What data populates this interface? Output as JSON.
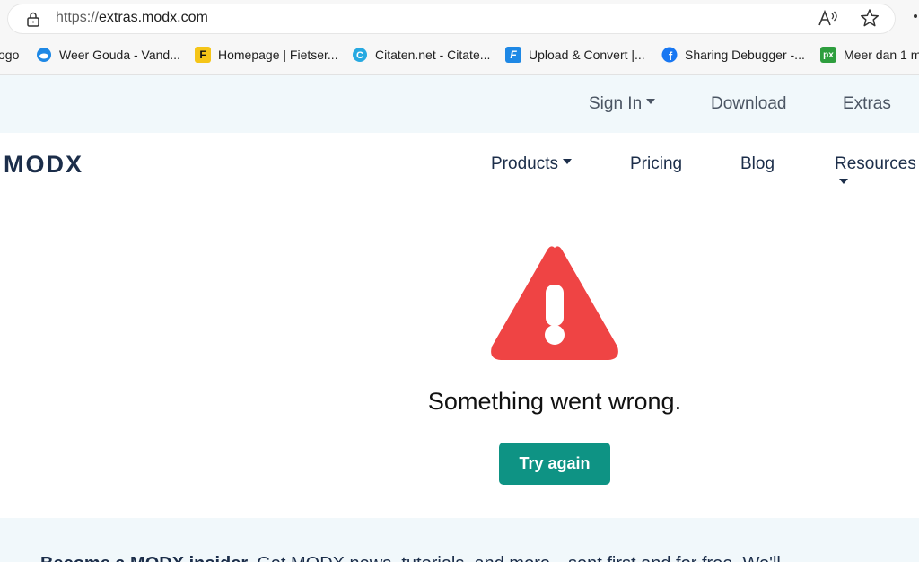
{
  "browser": {
    "url_scheme": "https://",
    "url_host": "extras.modx.com",
    "read_aloud_label": "A",
    "bookmarks": [
      {
        "label": "ogo",
        "icon": "generic-icon",
        "color": "#999999"
      },
      {
        "label": "Weer Gouda - Vand...",
        "icon": "weather-icon",
        "color": "#1e88e5"
      },
      {
        "label": "Homepage | Fietser...",
        "icon": "f-icon",
        "color": "#f5c518"
      },
      {
        "label": "Citaten.net - Citate...",
        "icon": "c-icon",
        "color": "#27a9e1"
      },
      {
        "label": "Upload & Convert |...",
        "icon": "f-convert-icon",
        "color": "#1e88e5"
      },
      {
        "label": "Sharing Debugger -...",
        "icon": "facebook-icon",
        "color": "#1877f2"
      },
      {
        "label": "Meer dan 1 m",
        "icon": "px-icon",
        "color": "#2e9e3e"
      }
    ]
  },
  "utilbar": {
    "sign_in": "Sign In",
    "download": "Download",
    "extras": "Extras"
  },
  "nav": {
    "logo": "MODX",
    "products": "Products",
    "pricing": "Pricing",
    "blog": "Blog",
    "resources": "Resources"
  },
  "error": {
    "message": "Something went wrong.",
    "button": "Try again",
    "warn_color": "#ef4444"
  },
  "footer": {
    "bold_text": "Become a MODX insider.",
    "text": " Get MODX news, tutorials, and more—sent first and for free. We'll"
  },
  "colors": {
    "accent": "#0e9384",
    "navy": "#1c2e4a",
    "band": "#f1f8fb"
  }
}
